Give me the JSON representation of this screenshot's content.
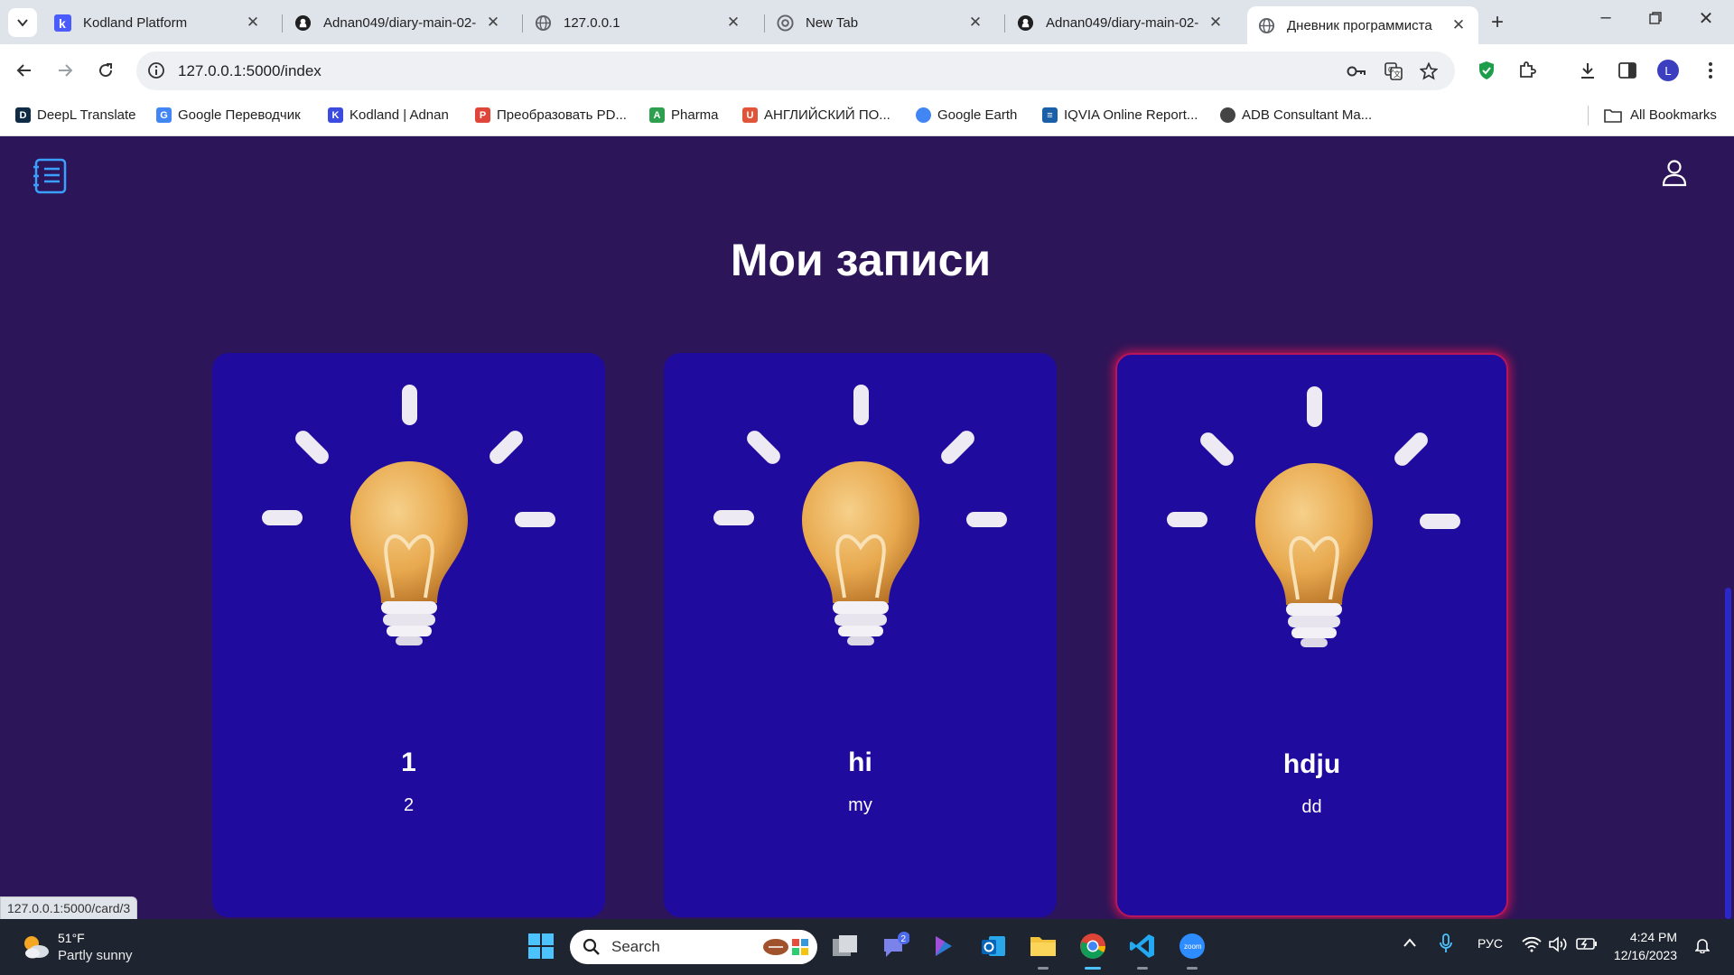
{
  "browser": {
    "tabs": [
      {
        "title": "Kodland Platform",
        "icon": "kodland-icon"
      },
      {
        "title": "Adnan049/diary-main-02-",
        "icon": "github-icon"
      },
      {
        "title": "127.0.0.1",
        "icon": "globe-icon"
      },
      {
        "title": "New Tab",
        "icon": "chrome-icon"
      },
      {
        "title": "Adnan049/diary-main-02-",
        "icon": "github-icon"
      },
      {
        "title": "Дневник программиста",
        "icon": "globe-icon",
        "active": true
      }
    ],
    "url": "127.0.0.1:5000/index",
    "profile_initial": "L",
    "bookmarks": [
      {
        "label": "DeepL Translate",
        "color": "#0f2b46",
        "glyph": "D"
      },
      {
        "label": "Google Переводчик",
        "color": "#4285f4",
        "glyph": "G"
      },
      {
        "label": "Kodland | Adnan",
        "color": "#3b4bdf",
        "glyph": "K"
      },
      {
        "label": "Преобразовать PD...",
        "color": "#e0453a",
        "glyph": "P"
      },
      {
        "label": "Pharma",
        "color": "#2e9e4f",
        "glyph": "A"
      },
      {
        "label": "АНГЛИЙСКИЙ ПО...",
        "color": "#e0553a",
        "glyph": "U"
      },
      {
        "label": "Google Earth",
        "color": "#4285f4",
        "glyph": "E"
      },
      {
        "label": "IQVIA Online Report...",
        "color": "#1a5fa8",
        "glyph": "≡"
      },
      {
        "label": "ADB Consultant Ma...",
        "color": "#444444",
        "glyph": "A"
      }
    ],
    "all_bookmarks": "All Bookmarks",
    "status_url": "127.0.0.1:5000/card/3"
  },
  "page": {
    "heading": "Мои записи",
    "cards": [
      {
        "title": "1",
        "text": "2"
      },
      {
        "title": "hi",
        "text": "my"
      },
      {
        "title": "hdju",
        "text": "dd"
      }
    ],
    "colors": {
      "background": "#2d1559",
      "card": "#200b9f",
      "hover_glow": "#c8145a",
      "icon": "#3aa0ff"
    }
  },
  "taskbar": {
    "weather_temp": "51°F",
    "weather_desc": "Partly sunny",
    "search_placeholder": "Search",
    "chat_badge": "2",
    "language": "РУС",
    "time": "4:24 PM",
    "date": "12/16/2023"
  }
}
